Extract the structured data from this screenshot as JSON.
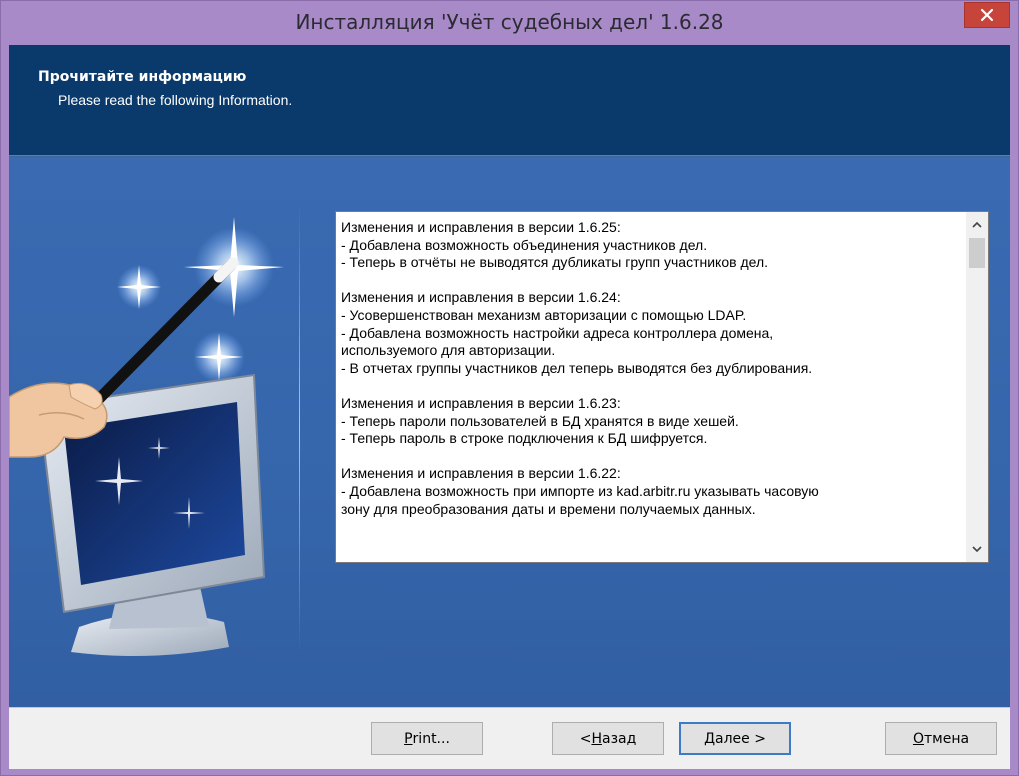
{
  "window": {
    "title": "Инсталляция 'Учёт судебных дел' 1.6.28"
  },
  "header": {
    "heading": "Прочитайте информацию",
    "subheading": "Please read the following Information."
  },
  "info": {
    "lines": [
      "Изменения и исправления в версии 1.6.25:",
      "- Добавлена возможность объединения участников дел.",
      "- Теперь в отчёты не выводятся дубликаты групп участников дел.",
      "",
      "Изменения и исправления в версии 1.6.24:",
      "- Усовершенствован механизм авторизации с помощью LDAP.",
      "- Добавлена возможность настройки адреса контроллера домена,",
      "используемого для авторизации.",
      "- В отчетах группы участников дел теперь выводятся без дублирования.",
      "",
      "Изменения и исправления в версии 1.6.23:",
      "- Теперь пароли пользователей в БД хранятся в виде хешей.",
      "- Теперь пароль в строке подключения к БД шифруется.",
      "",
      "Изменения и исправления в версии 1.6.22:",
      "- Добавлена возможность при импорте из kad.arbitr.ru указывать часовую",
      "зону для преобразования даты и времени получаемых данных."
    ]
  },
  "buttons": {
    "print": {
      "mnemonic": "P",
      "rest": "rint..."
    },
    "back": {
      "prefix": "< ",
      "mnemonic": "Н",
      "rest": "азад"
    },
    "next": {
      "mnemonic": "Д",
      "rest": "алее >"
    },
    "cancel": {
      "mnemonic": "О",
      "rest": "тмена"
    }
  },
  "icons": {
    "close": "close-icon",
    "scroll_up": "chevron-up-icon",
    "scroll_down": "chevron-down-icon",
    "art": "magic-wand-monitor-icon"
  },
  "colors": {
    "titlebar": "#a98ac9",
    "header": "#0a3a6b",
    "body": "#3a6bb2",
    "close": "#c7443a"
  }
}
